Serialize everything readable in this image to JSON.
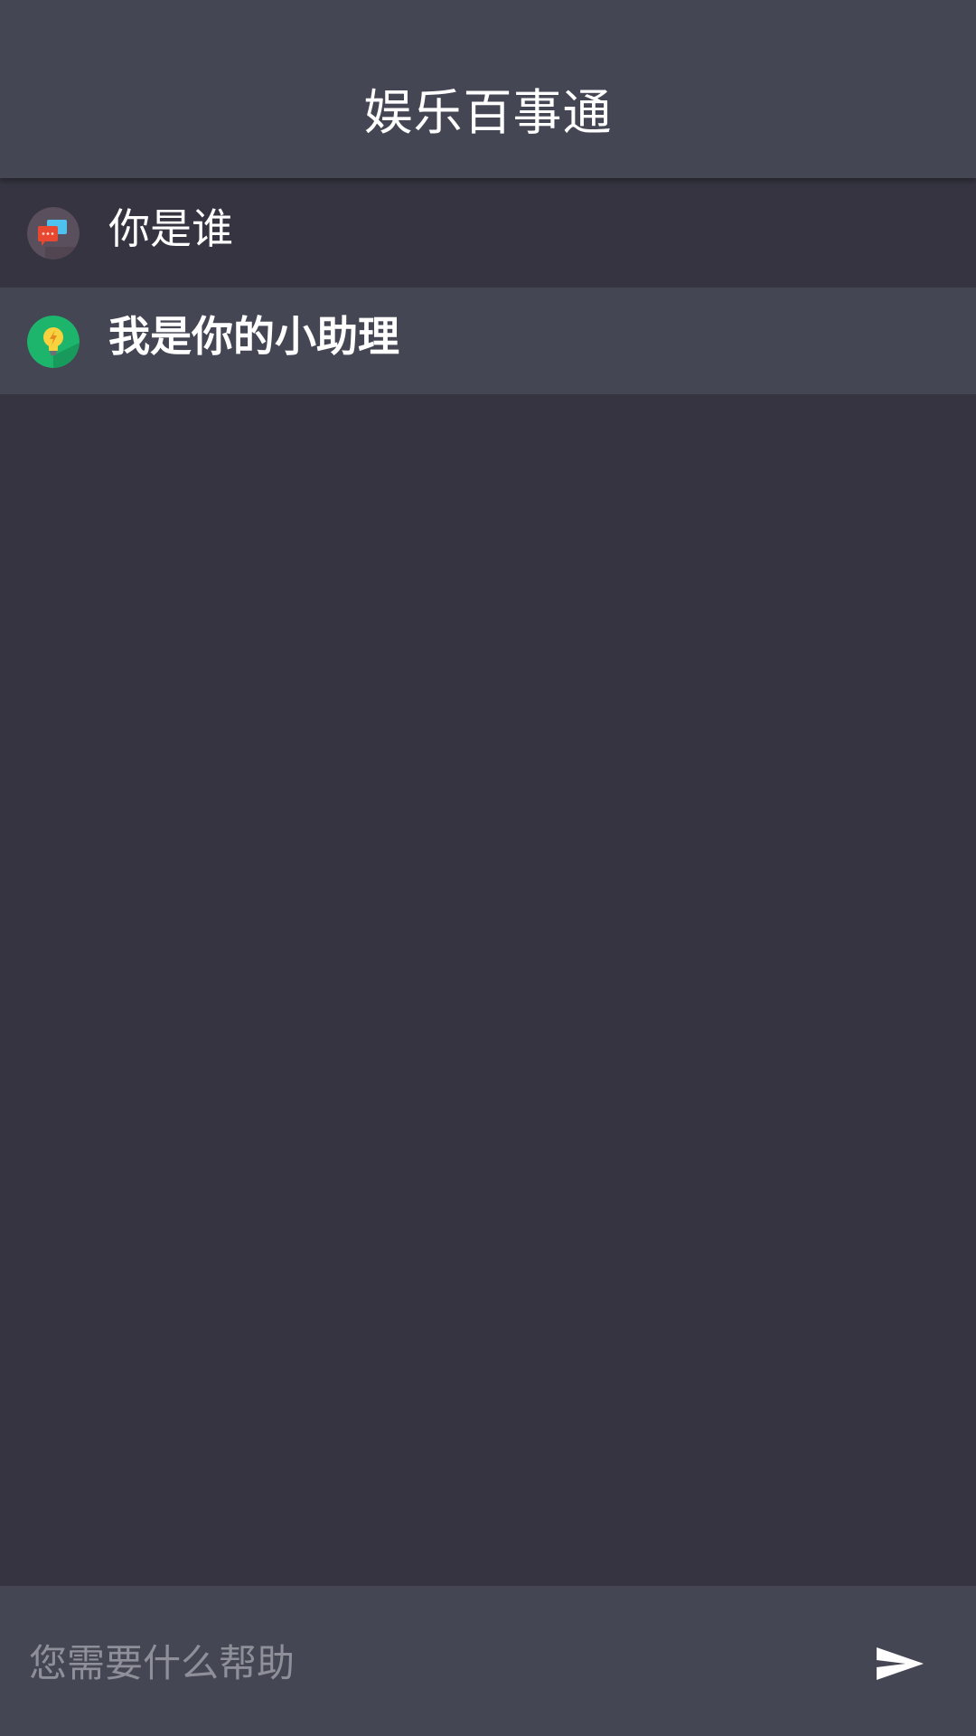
{
  "header": {
    "title": "娱乐百事通"
  },
  "messages": [
    {
      "sender": "user",
      "avatar_icon": "chat-bubbles-icon",
      "text": "你是谁"
    },
    {
      "sender": "bot",
      "avatar_icon": "lightbulb-icon",
      "text": "我是你的小助理"
    }
  ],
  "input": {
    "value": "",
    "placeholder": "您需要什么帮助"
  },
  "send": {
    "icon": "send-icon"
  },
  "colors": {
    "background": "#353440",
    "header_bg": "#454653",
    "bot_row_bg": "#454653",
    "text": "#ffffff",
    "placeholder": "#8e8f99",
    "bot_avatar_bg": "#1db56b",
    "bulb": "#f7d23e"
  }
}
